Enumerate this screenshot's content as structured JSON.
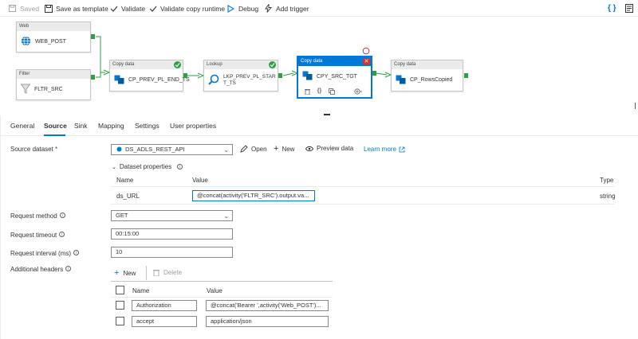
{
  "toolbar": {
    "saved": "Saved",
    "save_as_template": "Save as template",
    "validate": "Validate",
    "validate_copy_runtime": "Validate copy runtime",
    "debug": "Debug",
    "add_trigger": "Add trigger"
  },
  "pipeline": {
    "nodes": [
      {
        "type": "Web",
        "name": "WEB_POST"
      },
      {
        "type": "Filter",
        "name": "FLTR_SRC"
      },
      {
        "type": "Copy data",
        "name": "CP_PREV_PL_END_TS"
      },
      {
        "type": "Lookup",
        "name": "LKP_PREV_PL_START_TS"
      },
      {
        "type": "Copy data",
        "name": "CPY_SRC_TGT"
      },
      {
        "type": "Copy data",
        "name": "CP_RowsCopied"
      }
    ]
  },
  "tabs": [
    "General",
    "Source",
    "Sink",
    "Mapping",
    "Settings",
    "User properties"
  ],
  "source": {
    "dataset_label": "Source dataset",
    "required_mark": "*",
    "dataset_value": "DS_ADLS_REST_API",
    "open": "Open",
    "new": "New",
    "preview": "Preview data",
    "learn_more": "Learn more",
    "dataset_properties": "Dataset properties",
    "props_headers": {
      "name": "Name",
      "value": "Value",
      "type": "Type"
    },
    "props_row": {
      "name": "ds_URL",
      "value": "@concat(activity('FLTR_SRC').output.va...",
      "type": "string"
    },
    "request_method_label": "Request method",
    "request_method": "GET",
    "request_timeout_label": "Request timeout",
    "request_timeout": "00:15:00",
    "request_interval_label": "Request interval (ms)",
    "request_interval": "10",
    "additional_headers_label": "Additional headers",
    "headers_new": "New",
    "headers_delete": "Delete",
    "headers_cols": {
      "name": "Name",
      "value": "Value"
    },
    "headers": [
      {
        "name": "Authorization",
        "value": "@concat('Bearer ',activity('Web_POST')..."
      },
      {
        "name": "accept",
        "value": "application/json"
      }
    ]
  },
  "colors": {
    "accent": "#0078d4",
    "success": "#2e9f45",
    "error": "#d13438"
  }
}
